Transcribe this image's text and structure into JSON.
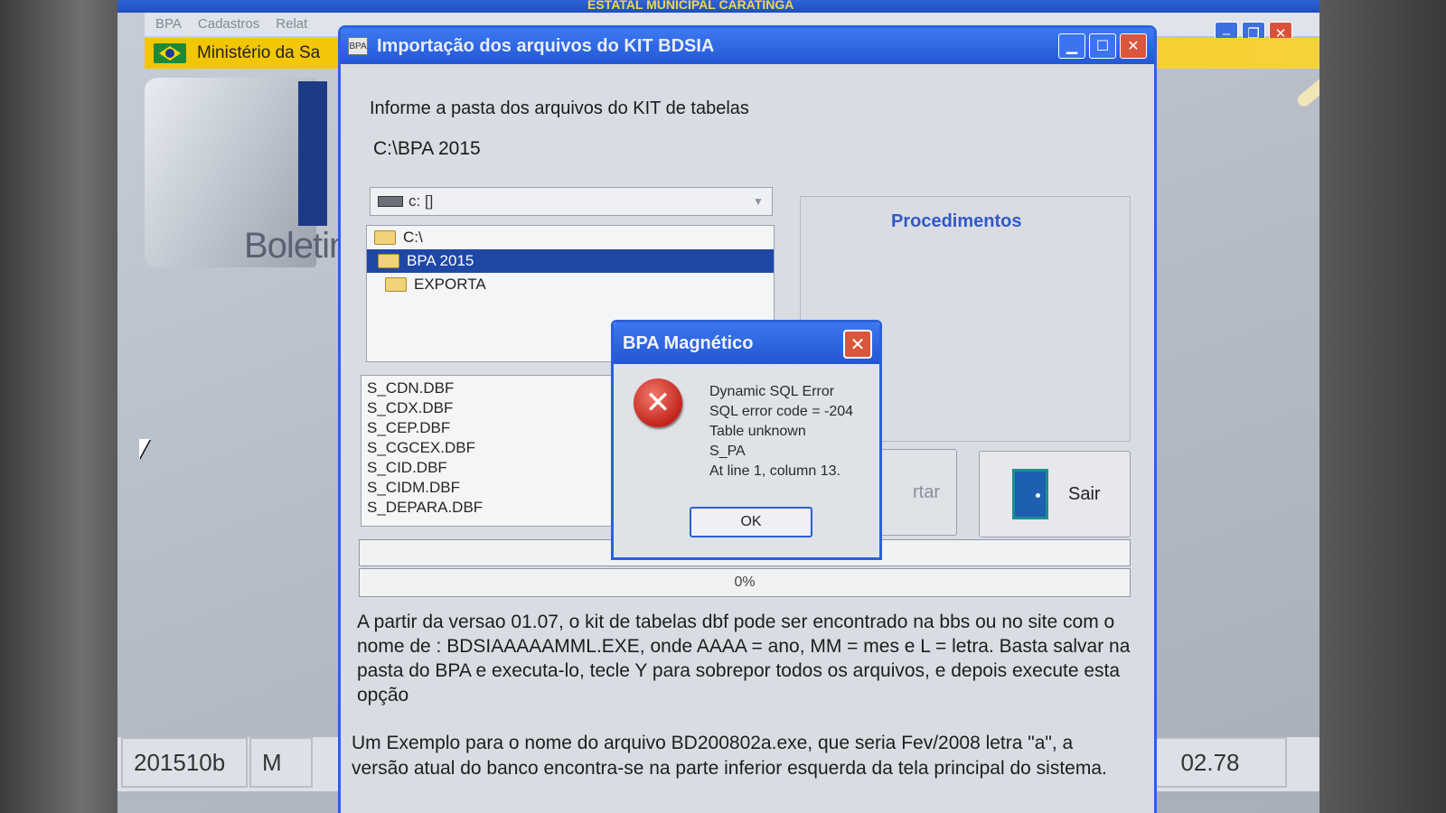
{
  "app": {
    "title_fragment": "ESTATAL MUNICIPAL CARATINGA",
    "menu": [
      "BPA",
      "Cadastros",
      "Relat"
    ],
    "ministerio": "Ministério da Sa",
    "boletim": "Boletim",
    "status": {
      "version": "201510b",
      "mode": "M",
      "right_value": "02.78"
    }
  },
  "import_dialog": {
    "title": "Importação dos arquivos do KIT BDSIA",
    "app_icon": "BPA",
    "instruction": "Informe a pasta dos arquivos do KIT de tabelas",
    "selected_path": "C:\\BPA 2015",
    "drive": "c: []",
    "directories": [
      {
        "label": "C:\\",
        "selected": false
      },
      {
        "label": "BPA 2015",
        "selected": true
      },
      {
        "label": "EXPORTA",
        "selected": false
      }
    ],
    "files": [
      "S_CDN.DBF",
      "S_CDX.DBF",
      "S_CEP.DBF",
      "S_CGCEX.DBF",
      "S_CID.DBF",
      "S_CIDM.DBF",
      "S_DEPARA.DBF"
    ],
    "procedures_label": "Procedimentos",
    "import_button": "rtar",
    "exit_button": "Sair",
    "progress": {
      "value": 0,
      "label": "0%"
    },
    "paragraph1": "A partir da versao 01.07, o kit de tabelas dbf pode ser encontrado na bbs ou no site com o nome de : BDSIAAAAAMML.EXE, onde AAAA = ano, MM = mes e L = letra. Basta salvar na pasta do BPA e executa-lo, tecle Y para sobrepor todos os arquivos, e depois execute esta opção",
    "paragraph2": "Um Exemplo para o nome do arquivo BD200802a.exe, que seria Fev/2008 letra \"a\", a versão atual do banco encontra-se na parte inferior esquerda da tela principal do sistema."
  },
  "error_box": {
    "title": "BPA Magnético",
    "lines": [
      "Dynamic SQL Error",
      "SQL error code = -204",
      "Table unknown",
      "S_PA",
      "At line 1, column 13."
    ],
    "ok_label": "OK"
  },
  "icons": {
    "error": "error-x-icon",
    "door": "door-exit-icon",
    "folder": "folder-icon",
    "drive": "drive-icon"
  },
  "colors": {
    "titlebar_blue": "#2b63dc",
    "selection_blue": "#1f47a6",
    "error_red": "#c3241d",
    "ministerio_yellow": "#f3c500"
  }
}
